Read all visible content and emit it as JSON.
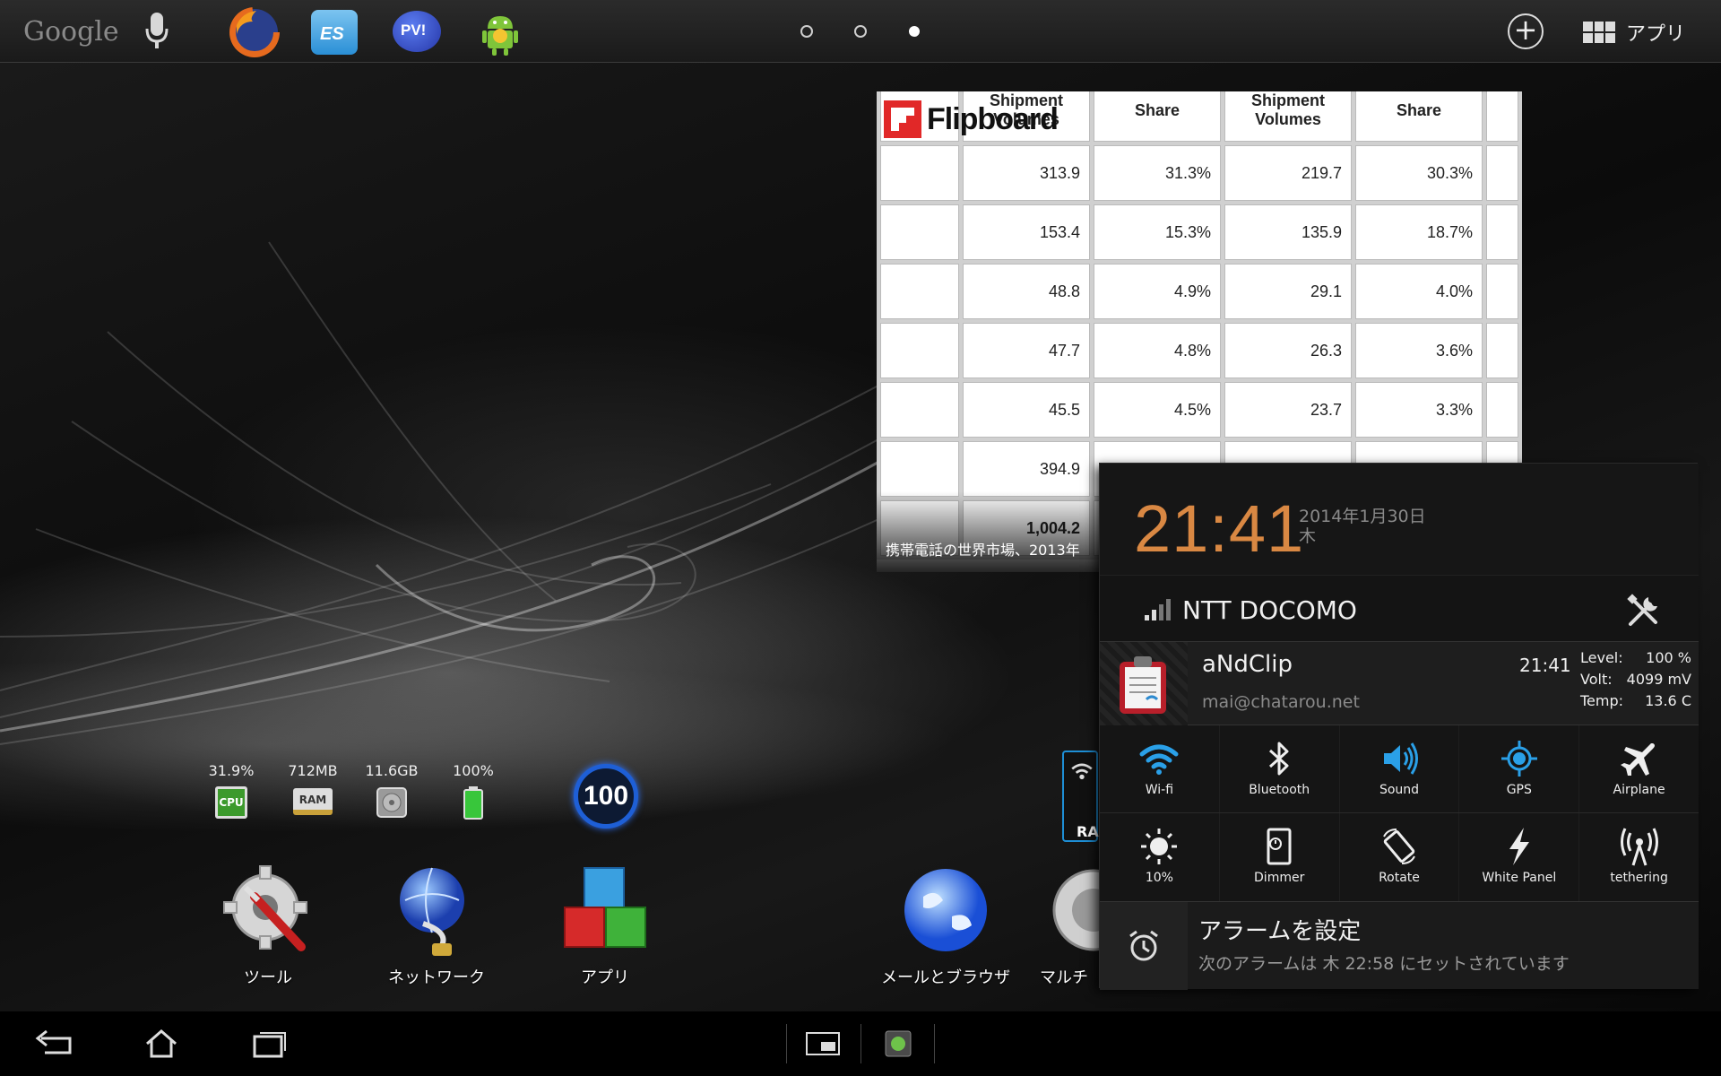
{
  "topbar": {
    "google_label": "Google",
    "dock_apps": [
      "firefox-icon",
      "es-file-explorer-icon",
      "pv-icon",
      "android-app-icon"
    ],
    "pv_label": "PV!",
    "es_label": "ES",
    "pager_active_index": 2,
    "add_label": "+",
    "apps_label": "アプリ"
  },
  "flipboard": {
    "brand": "Flipboard",
    "caption": "携帯電話の世界市場、2013年",
    "headers": [
      "",
      "Shipment Volumes",
      "Share",
      "Shipment Volumes",
      "Share",
      ""
    ],
    "rows": [
      [
        "",
        "313.9",
        "31.3%",
        "219.7",
        "30.3%",
        ""
      ],
      [
        "",
        "153.4",
        "15.3%",
        "135.9",
        "18.7%",
        ""
      ],
      [
        "",
        "48.8",
        "4.9%",
        "29.1",
        "4.0%",
        ""
      ],
      [
        "",
        "47.7",
        "4.8%",
        "26.3",
        "3.6%",
        ""
      ],
      [
        "",
        "45.5",
        "4.5%",
        "23.7",
        "3.3%",
        ""
      ],
      [
        "",
        "394.9",
        "",
        "",
        "",
        ""
      ],
      [
        "",
        "1,004.2",
        "",
        "",
        "",
        ""
      ]
    ]
  },
  "stats": {
    "cpu_value": "31.9%",
    "cpu_icon_label": "CPU",
    "ram_value": "712MB",
    "ram_icon_label": "RAM",
    "storage_value": "11.6GB",
    "battery_value": "100%",
    "booster_value": "100",
    "partial_label": "RA"
  },
  "shortcuts": [
    {
      "label": "ツール",
      "icon": "gear-wrench-icon"
    },
    {
      "label": "ネットワーク",
      "icon": "globe-network-icon"
    },
    {
      "label": "アプリ",
      "icon": "cubes-icon"
    },
    {
      "label": "メールとブラウザ",
      "icon": "globe-icon"
    },
    {
      "label": "マルチ",
      "icon": "speaker-icon"
    }
  ],
  "notification": {
    "time": "21:41",
    "date_line1": "2014年1月30日",
    "date_line2": "木",
    "carrier": "NTT DOCOMO",
    "app": {
      "name": "aNdClip",
      "subtitle": "mai@chatarou.net",
      "time": "21:41"
    },
    "battery": {
      "level_label": "Level:",
      "level_value": "100 %",
      "volt_label": "Volt:",
      "volt_value": "4099 mV",
      "temp_label": "Temp:",
      "temp_value": "13.6 C"
    },
    "toggles_row1": [
      {
        "label": "Wi-fi",
        "icon": "wifi-icon",
        "active": true
      },
      {
        "label": "Bluetooth",
        "icon": "bluetooth-icon",
        "active": false
      },
      {
        "label": "Sound",
        "icon": "sound-icon",
        "active": true
      },
      {
        "label": "GPS",
        "icon": "gps-icon",
        "active": true
      },
      {
        "label": "Airplane",
        "icon": "airplane-icon",
        "active": false
      }
    ],
    "toggles_row2": [
      {
        "label": "10%",
        "icon": "brightness-icon",
        "active": false
      },
      {
        "label": "Dimmer",
        "icon": "dimmer-icon",
        "active": false
      },
      {
        "label": "Rotate",
        "icon": "rotate-icon",
        "active": false
      },
      {
        "label": "White Panel",
        "icon": "flash-icon",
        "active": false
      },
      {
        "label": "tethering",
        "icon": "tethering-icon",
        "active": false
      }
    ],
    "alarm": {
      "title": "アラームを設定",
      "subtitle": "次のアラームは 木 22:58 にセットされています"
    }
  },
  "colors": {
    "accent_blue": "#2aa0e8",
    "clock_orange": "#d98843",
    "flipboard_red": "#e12828"
  }
}
